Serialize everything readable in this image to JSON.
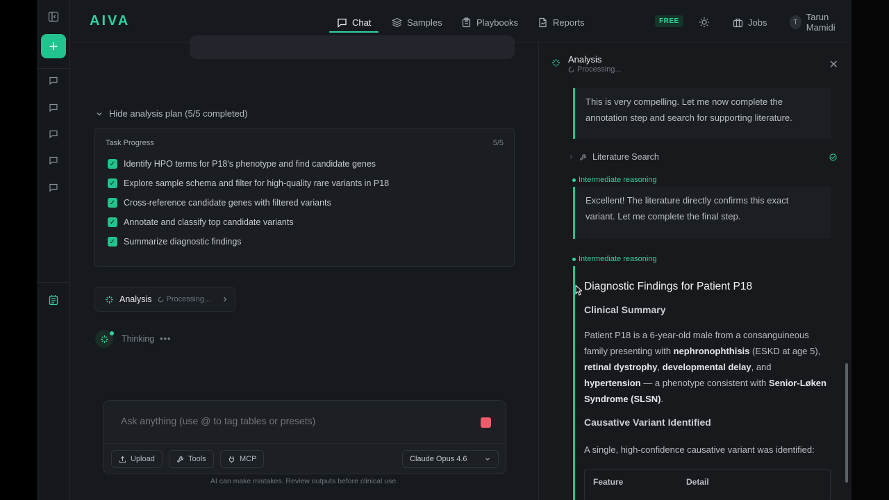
{
  "app": {
    "logo": "AIVA"
  },
  "nav": {
    "chat": "Chat",
    "samples": "Samples",
    "playbooks": "Playbooks",
    "reports": "Reports",
    "free_badge": "FREE",
    "jobs": "Jobs",
    "user_initial": "T",
    "user_name": "Tarun Mamidi"
  },
  "plan": {
    "toggle_label": "Hide analysis plan (5/5 completed)",
    "title": "Task Progress",
    "count": "5/5",
    "tasks": [
      {
        "label": "Identify HPO terms for P18's phenotype and find candidate genes",
        "done": true
      },
      {
        "label": "Explore sample schema and filter for high-quality rare variants in P18",
        "done": true
      },
      {
        "label": "Cross-reference candidate genes with filtered variants",
        "done": true
      },
      {
        "label": "Annotate and classify top candidate variants",
        "done": true
      },
      {
        "label": "Summarize diagnostic findings",
        "done": true
      }
    ]
  },
  "analysis_chip": {
    "label": "Analysis",
    "status": "Processing..."
  },
  "thinking": {
    "label": "Thinking",
    "dots": "•••"
  },
  "composer": {
    "placeholder": "Ask anything (use @ to tag tables or presets)",
    "upload": "Upload",
    "tools": "Tools",
    "mcp": "MCP",
    "model": "Claude Opus 4.6",
    "disclaimer": "AI can make mistakes. Review outputs before clinical use."
  },
  "panel": {
    "title": "Analysis",
    "status": "Processing...",
    "block1": "This is very compelling. Let me now complete the annotation step and search for supporting literature.",
    "step_literature": "Literature Search",
    "reason_label": "Intermediate reasoning",
    "block2": "Excellent! The literature directly confirms this exact variant. Let me complete the final step.",
    "findings": {
      "title": "Diagnostic Findings for Patient P18",
      "clinical_heading": "Clinical Summary",
      "p1_a": "Patient P18 is a 6-year-old male from a consanguineous family presenting with ",
      "p1_b": "nephronophthisis",
      "p1_c": " (ESKD at age 5), ",
      "p1_d": "retinal dystrophy",
      "p1_e": ", ",
      "p1_f": "developmental delay",
      "p1_g": ", and ",
      "p1_h": "hypertension",
      "p1_i": " — a phenotype consistent with ",
      "p1_j": "Senior-Løken Syndrome (SLSN)",
      "p1_k": ".",
      "variant_heading": "Causative Variant Identified",
      "p2": "A single, high-confidence causative variant was identified:",
      "table_headers": [
        "Feature",
        "Detail"
      ]
    }
  },
  "colors": {
    "accent": "#2dd4a0",
    "stop": "#ef5b6a",
    "background": "#16191d"
  }
}
